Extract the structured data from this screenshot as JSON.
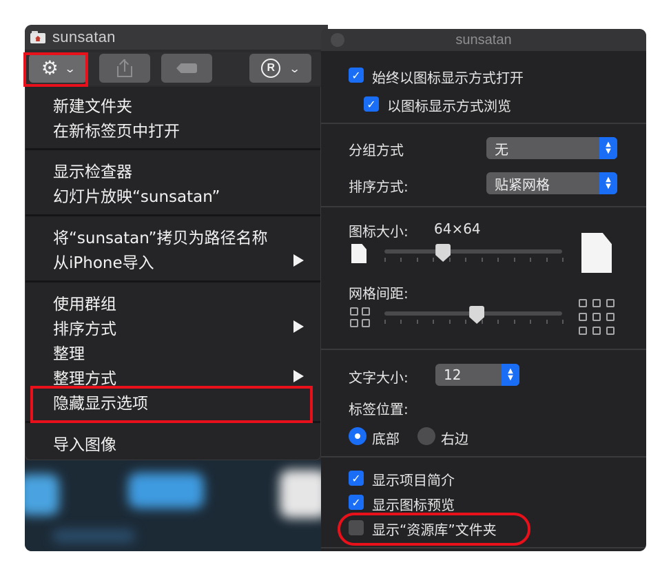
{
  "finder": {
    "title": "sunsatan",
    "toolbar": {
      "action_icon": "gear-icon",
      "share_icon": "share-icon",
      "tag_icon": "tag-icon",
      "registered_icon": "registered-icon",
      "registered_glyph": "R"
    }
  },
  "menu": {
    "items": [
      {
        "label": "新建文件夹"
      },
      {
        "label": "在新标签页中打开"
      },
      {
        "label": "显示检查器"
      },
      {
        "label": "幻灯片放映“sunsatan”"
      },
      {
        "label": "将“sunsatan”拷贝为路径名称"
      },
      {
        "label": "从iPhone导入"
      },
      {
        "label": "使用群组"
      },
      {
        "label": "排序方式"
      },
      {
        "label": "整理"
      },
      {
        "label": "整理方式"
      },
      {
        "label": "隐藏显示选项"
      },
      {
        "label": "导入图像"
      }
    ]
  },
  "inspector": {
    "title": "sunsatan",
    "always_icon_view": {
      "label": "始终以图标显示方式打开",
      "checked": true
    },
    "browse_icon_view": {
      "label": "以图标显示方式浏览",
      "checked": true
    },
    "group_by": {
      "label": "分组方式",
      "value": "无"
    },
    "sort_by": {
      "label": "排序方式:",
      "value": "贴紧网格"
    },
    "icon_size": {
      "label": "图标大小:",
      "value": "64×64",
      "fraction": 0.33
    },
    "grid_spacing": {
      "label": "网格间距:",
      "fraction": 0.52
    },
    "text_size": {
      "label": "文字大小:",
      "value": "12"
    },
    "label_position": {
      "label": "标签位置:",
      "options": [
        "底部",
        "右边"
      ],
      "selected": "底部"
    },
    "show_item_info": {
      "label": "显示项目简介",
      "checked": true
    },
    "show_icon_preview": {
      "label": "显示图标预览",
      "checked": true
    },
    "show_library_folder": {
      "label": "显示“资源库”文件夹",
      "checked": false
    }
  }
}
